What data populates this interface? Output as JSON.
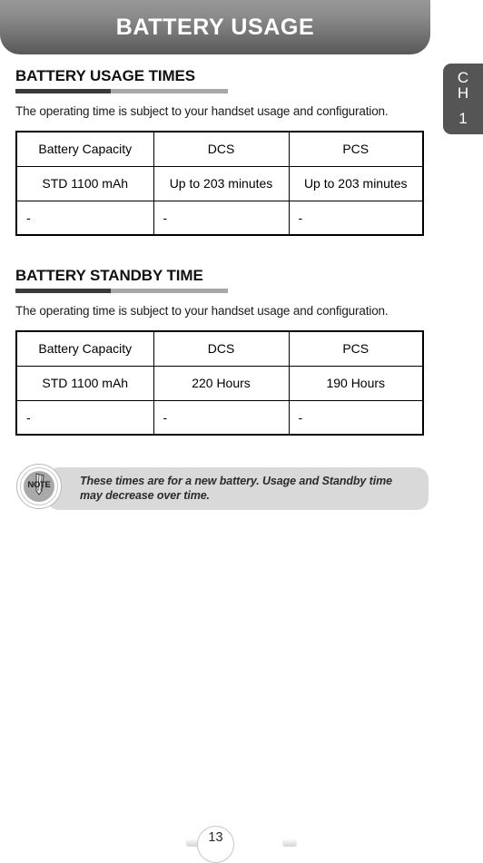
{
  "banner": {
    "title": "BATTERY USAGE"
  },
  "chapter_tab": {
    "line1": "C",
    "line2": "H",
    "number": "1"
  },
  "sections": [
    {
      "heading": "BATTERY USAGE TIMES",
      "description": "The operating time is subject to your handset usage and configuration.",
      "table": {
        "headers": [
          "Battery Capacity",
          "DCS",
          "PCS"
        ],
        "rows": [
          [
            "STD 1100 mAh",
            "Up to 203 minutes",
            "Up to 203 minutes"
          ],
          [
            "-",
            "-",
            "-"
          ]
        ]
      }
    },
    {
      "heading": "BATTERY STANDBY TIME",
      "description": "The operating time is subject to your handset usage and configuration.",
      "table": {
        "headers": [
          "Battery Capacity",
          "DCS",
          "PCS"
        ],
        "rows": [
          [
            "STD 1100 mAh",
            "220 Hours",
            "190 Hours"
          ],
          [
            "-",
            "-",
            "-"
          ]
        ]
      }
    }
  ],
  "note": {
    "badge_label": "NOTE",
    "text": "These times are for a new battery. Usage and Standby time may decrease over time."
  },
  "footer": {
    "page_number": "13"
  },
  "colors": {
    "banner_top": "#979797",
    "banner_bottom": "#585858",
    "tab_bg": "#555555",
    "rule_dark": "#3a3a3a",
    "rule_light": "#a8a8a8",
    "note_bg": "#d9d9d9"
  }
}
